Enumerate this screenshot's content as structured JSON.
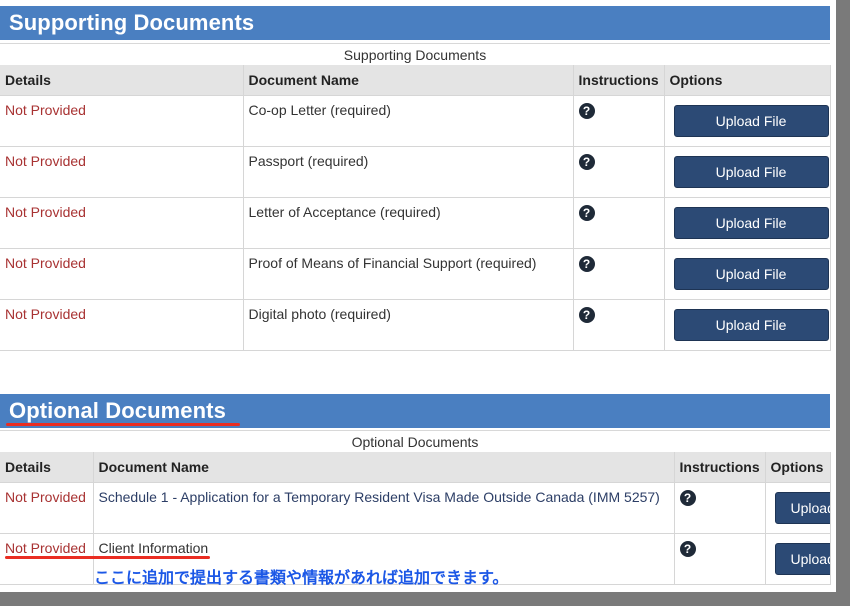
{
  "supporting": {
    "header": "Supporting Documents",
    "caption": "Supporting Documents",
    "columns": [
      "Details",
      "Document Name",
      "Instructions",
      "Options"
    ],
    "rows": [
      {
        "status": "Not Provided",
        "doc": "Co-op Letter  (required)",
        "action": "Upload File"
      },
      {
        "status": "Not Provided",
        "doc": "Passport  (required)",
        "action": "Upload File"
      },
      {
        "status": "Not Provided",
        "doc": "Letter of Acceptance  (required)",
        "action": "Upload File"
      },
      {
        "status": "Not Provided",
        "doc": "Proof of Means of Financial Support  (required)",
        "action": "Upload File"
      },
      {
        "status": "Not Provided",
        "doc": "Digital photo  (required)",
        "action": "Upload File"
      }
    ]
  },
  "optional": {
    "header": "Optional Documents",
    "caption": "Optional Documents",
    "columns": [
      "Details",
      "Document Name",
      "Instructions",
      "Options"
    ],
    "rows": [
      {
        "status": "Not Provided",
        "doc": "Schedule 1 - Application for a Temporary Resident Visa Made Outside Canada (IMM 5257)",
        "action": "Upload File"
      },
      {
        "status": "Not Provided",
        "doc": "Client Information",
        "action": "Upload File"
      }
    ]
  },
  "help_glyph": "?",
  "annotation": "ここに追加で提出する書類や情報があれば追加できます。",
  "colors": {
    "header_bg": "#4a7fc1",
    "status_text": "#a83232",
    "button_bg": "#2c4a75",
    "highlight": "#ea2d22",
    "annotation": "#1b57e6"
  }
}
